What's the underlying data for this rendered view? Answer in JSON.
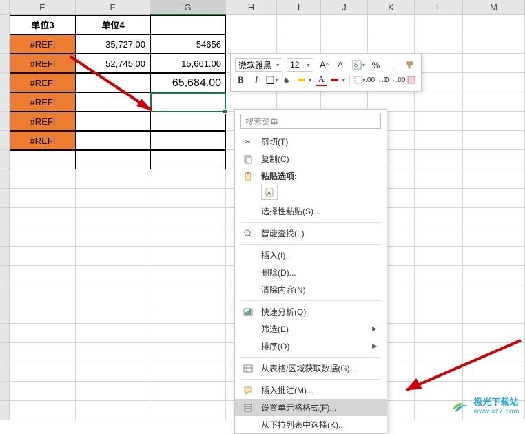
{
  "columns": [
    "E",
    "F",
    "G",
    "H",
    "I",
    "J",
    "K",
    "L",
    "M"
  ],
  "headers": {
    "E": "单位3",
    "F": "单位4"
  },
  "rows": {
    "r1": {
      "E": "#REF!",
      "F": "35,727.00",
      "G": "54656"
    },
    "r2": {
      "E": "#REF!",
      "F": "52,745.00",
      "G": "15,661.00"
    },
    "r3": {
      "E": "#REF!",
      "G": "65,684.00"
    },
    "r4": {
      "E": "#REF!"
    },
    "r5": {
      "E": "#REF!"
    },
    "r6": {
      "E": "#REF!"
    }
  },
  "mini_toolbar": {
    "font": "微软雅黑",
    "size": "12",
    "btn_incA": "A",
    "btn_decA": "A",
    "btn_percent": "%",
    "btn_comma": ",",
    "btn_B": "B",
    "btn_I": "I",
    "btn_underA": "A"
  },
  "context_menu": {
    "search_placeholder": "搜索菜单",
    "cut": "剪切(T)",
    "copy": "复制(C)",
    "paste_options": "粘贴选项:",
    "paste_special": "选择性粘贴(S)...",
    "smart_lookup": "智能查找(L)",
    "insert": "插入(I)...",
    "delete": "删除(D)...",
    "clear": "清除内容(N)",
    "quick_analysis": "快速分析(Q)",
    "filter": "筛选(E)",
    "sort": "排序(O)",
    "get_data": "从表格/区域获取数据(G)...",
    "insert_comment": "插入批注(M)...",
    "format_cells": "设置单元格格式(F)...",
    "pick_list": "从下拉列表中选择(K)..."
  },
  "watermark": {
    "brand": "极光下载站",
    "url": "www.xz7.com"
  }
}
